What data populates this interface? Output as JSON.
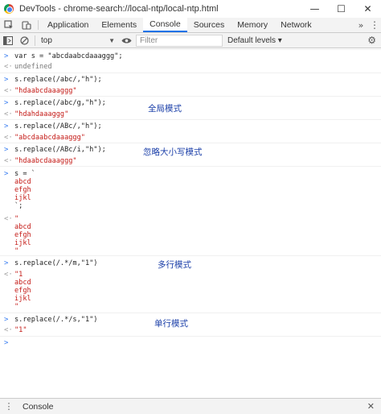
{
  "window": {
    "title": "DevTools - chrome-search://local-ntp/local-ntp.html",
    "minimize": "—",
    "maximize": "☐",
    "close": "✕"
  },
  "tabs": [
    "Application",
    "Elements",
    "Console",
    "Sources",
    "Memory",
    "Network"
  ],
  "active_tab": "Console",
  "toolbar": {
    "context": "top",
    "filter_placeholder": "Filter",
    "levels": "Default levels ▾"
  },
  "console": {
    "entries": [
      {
        "input": "var s = \"abcdaabcdaaaggg\";",
        "output": "undefined"
      },
      {
        "input": "s.replace(/abc/,\"h\");",
        "output": "\"hdaabcdaaaggg\""
      },
      {
        "input": "s.replace(/abc/g,\"h\");",
        "output": "\"hdahdaaaggg\""
      },
      {
        "input": "s.replace(/ABc/,\"h\");",
        "output": "\"abcdaabcdaaaggg\""
      },
      {
        "input": "s.replace(/ABc/i,\"h\");",
        "output": "\"hdaabcdaaaggg\""
      },
      {
        "input": "s = `",
        "input_cont": [
          "abcd",
          "efgh",
          "ijkl",
          "`;"
        ],
        "output": "\"",
        "output_cont": [
          "abcd",
          "efgh",
          "ijkl",
          "\""
        ]
      },
      {
        "input": "s.replace(/.*/m,\"1\")",
        "output": "\"1",
        "output_cont": [
          "abcd",
          "efgh",
          "ijkl",
          "\""
        ]
      },
      {
        "input": "s.replace(/.*/s,\"1\")",
        "output": "\"1\""
      }
    ],
    "notes": [
      "全局模式",
      "忽略大小写模式",
      "多行模式",
      "单行模式"
    ]
  },
  "drawer": {
    "tab": "Console"
  }
}
